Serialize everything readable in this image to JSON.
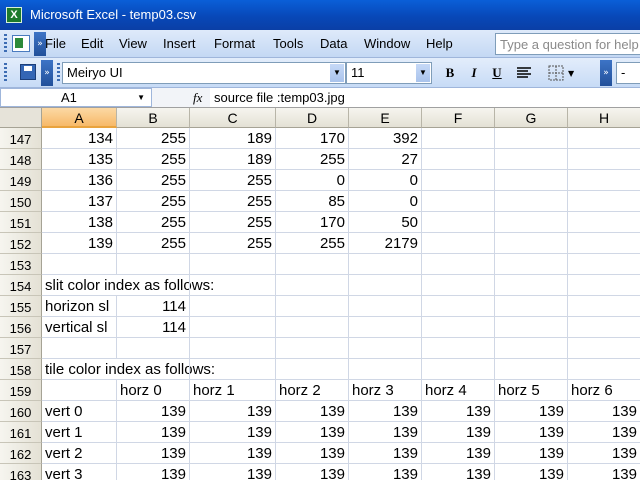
{
  "window": {
    "title": "Microsoft Excel - temp03.csv",
    "app_icon": "excel-icon"
  },
  "menu": {
    "items": [
      "File",
      "Edit",
      "View",
      "Insert",
      "Format",
      "Tools",
      "Data",
      "Window",
      "Help"
    ],
    "help_placeholder": "Type a question for help"
  },
  "toolbar": {
    "font_name": "Meiryo UI",
    "font_size": "11",
    "bold_label": "B",
    "italic_label": "I",
    "underline_label": "U"
  },
  "formula_bar": {
    "name_box": "A1",
    "fx_label": "fx",
    "content": "source file :temp03.jpg"
  },
  "columns": [
    "A",
    "B",
    "C",
    "D",
    "E",
    "F",
    "G",
    "H"
  ],
  "selected_column": "A",
  "rows": [
    {
      "num": "147",
      "cells": [
        "134",
        "255",
        "189",
        "170",
        "392",
        "",
        "",
        ""
      ]
    },
    {
      "num": "148",
      "cells": [
        "135",
        "255",
        "189",
        "255",
        "27",
        "",
        "",
        ""
      ]
    },
    {
      "num": "149",
      "cells": [
        "136",
        "255",
        "255",
        "0",
        "0",
        "",
        "",
        ""
      ]
    },
    {
      "num": "150",
      "cells": [
        "137",
        "255",
        "255",
        "85",
        "0",
        "",
        "",
        ""
      ]
    },
    {
      "num": "151",
      "cells": [
        "138",
        "255",
        "255",
        "170",
        "50",
        "",
        "",
        ""
      ]
    },
    {
      "num": "152",
      "cells": [
        "139",
        "255",
        "255",
        "255",
        "2179",
        "",
        "",
        ""
      ]
    },
    {
      "num": "153",
      "cells": [
        "",
        "",
        "",
        "",
        "",
        "",
        "",
        ""
      ]
    },
    {
      "num": "154",
      "cells": [
        "slit color index as follows:",
        "",
        "",
        "",
        "",
        "",
        "",
        ""
      ]
    },
    {
      "num": "155",
      "cells": [
        "horizon sl",
        "114",
        "",
        "",
        "",
        "",
        "",
        ""
      ]
    },
    {
      "num": "156",
      "cells": [
        "vertical sl",
        "114",
        "",
        "",
        "",
        "",
        "",
        ""
      ]
    },
    {
      "num": "157",
      "cells": [
        "",
        "",
        "",
        "",
        "",
        "",
        "",
        ""
      ]
    },
    {
      "num": "158",
      "cells": [
        "tile color index as follows:",
        "",
        "",
        "",
        "",
        "",
        "",
        ""
      ]
    },
    {
      "num": "159",
      "cells": [
        "",
        "horz 0",
        "horz 1",
        "horz 2",
        "horz 3",
        "horz 4",
        "horz 5",
        "horz 6"
      ]
    },
    {
      "num": "160",
      "cells": [
        "vert 0",
        "139",
        "139",
        "139",
        "139",
        "139",
        "139",
        "139"
      ]
    },
    {
      "num": "161",
      "cells": [
        "vert 1",
        "139",
        "139",
        "139",
        "139",
        "139",
        "139",
        "139"
      ]
    },
    {
      "num": "162",
      "cells": [
        "vert 2",
        "139",
        "139",
        "139",
        "139",
        "139",
        "139",
        "139"
      ]
    },
    {
      "num": "163",
      "cells": [
        "vert 3",
        "139",
        "139",
        "139",
        "139",
        "139",
        "139",
        "139"
      ]
    }
  ]
}
